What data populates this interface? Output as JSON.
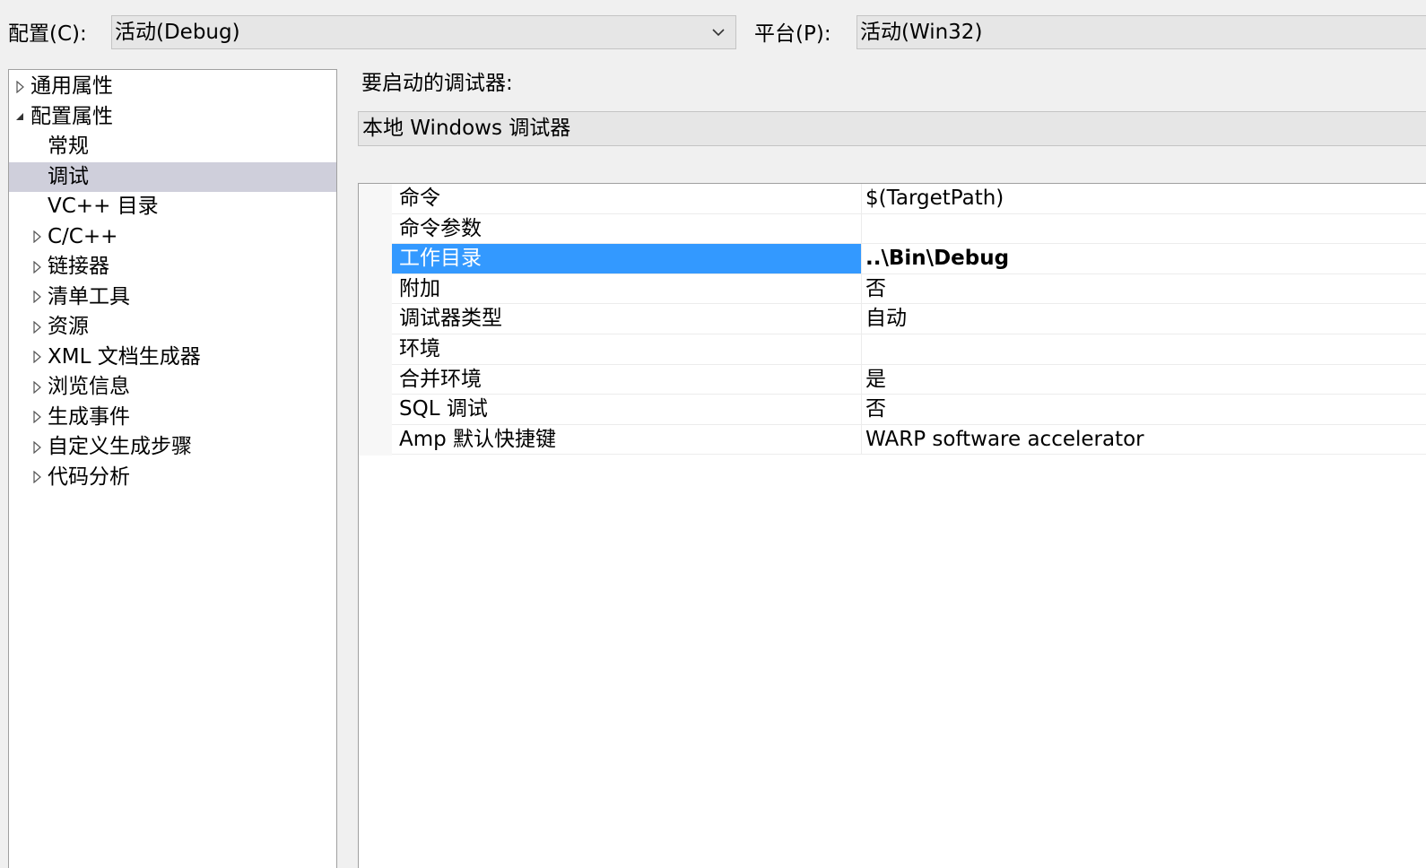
{
  "config": {
    "label": "配置(C):",
    "value": "活动(Debug)"
  },
  "platform": {
    "label": "平台(P):",
    "value": "活动(Win32)"
  },
  "tree": {
    "items": [
      {
        "label": "通用属性",
        "expander": "collapsed"
      },
      {
        "label": "配置属性",
        "expander": "expanded"
      },
      {
        "label": "常规",
        "expander": "none"
      },
      {
        "label": "调试",
        "expander": "none",
        "selected": true
      },
      {
        "label": "VC++ 目录",
        "expander": "none"
      },
      {
        "label": "C/C++",
        "expander": "collapsed"
      },
      {
        "label": "链接器",
        "expander": "collapsed"
      },
      {
        "label": "清单工具",
        "expander": "collapsed"
      },
      {
        "label": "资源",
        "expander": "collapsed"
      },
      {
        "label": "XML 文档生成器",
        "expander": "collapsed"
      },
      {
        "label": "浏览信息",
        "expander": "collapsed"
      },
      {
        "label": "生成事件",
        "expander": "collapsed"
      },
      {
        "label": "自定义生成步骤",
        "expander": "collapsed"
      },
      {
        "label": "代码分析",
        "expander": "collapsed"
      }
    ]
  },
  "debugger": {
    "label": "要启动的调试器:",
    "value": "本地 Windows 调试器"
  },
  "properties": [
    {
      "name": "命令",
      "value": "$(TargetPath)"
    },
    {
      "name": "命令参数",
      "value": ""
    },
    {
      "name": "工作目录",
      "value": "..\\Bin\\Debug",
      "selected": true
    },
    {
      "name": "附加",
      "value": "否"
    },
    {
      "name": "调试器类型",
      "value": "自动"
    },
    {
      "name": "环境",
      "value": ""
    },
    {
      "name": "合并环境",
      "value": "是"
    },
    {
      "name": "SQL 调试",
      "value": "否"
    },
    {
      "name": "Amp 默认快捷键",
      "value": "WARP software accelerator"
    }
  ],
  "colors": {
    "selection": "#3399ff",
    "tree_selection": "#cfcfdb",
    "combo_bg": "#e6e6e6"
  }
}
